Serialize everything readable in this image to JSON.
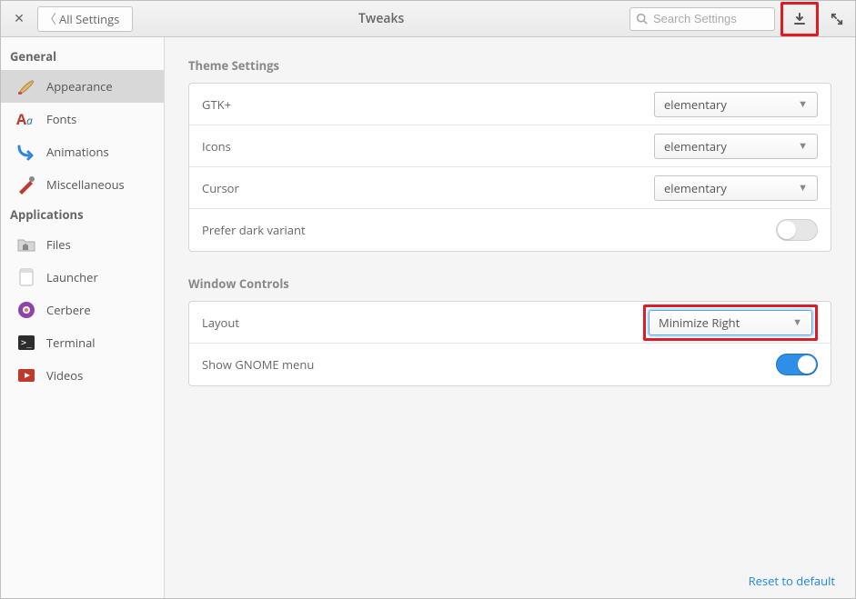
{
  "titlebar": {
    "back_label": "All Settings",
    "title": "Tweaks",
    "search_placeholder": "Search Settings"
  },
  "sidebar": {
    "groups": [
      {
        "header": "General",
        "items": [
          {
            "id": "appearance",
            "label": "Appearance",
            "icon": "brush",
            "selected": true
          },
          {
            "id": "fonts",
            "label": "Fonts",
            "icon": "fonts"
          },
          {
            "id": "animations",
            "label": "Animations",
            "icon": "arrow"
          },
          {
            "id": "misc",
            "label": "Miscellaneous",
            "icon": "knife"
          }
        ]
      },
      {
        "header": "Applications",
        "items": [
          {
            "id": "files",
            "label": "Files",
            "icon": "folder"
          },
          {
            "id": "launcher",
            "label": "Launcher",
            "icon": "page"
          },
          {
            "id": "cerbere",
            "label": "Cerbere",
            "icon": "gear"
          },
          {
            "id": "terminal",
            "label": "Terminal",
            "icon": "terminal"
          },
          {
            "id": "videos",
            "label": "Videos",
            "icon": "play"
          }
        ]
      }
    ]
  },
  "sections": {
    "theme": {
      "title": "Theme Settings",
      "rows": {
        "gtk": {
          "label": "GTK+",
          "value": "elementary"
        },
        "icons": {
          "label": "Icons",
          "value": "elementary"
        },
        "cursor": {
          "label": "Cursor",
          "value": "elementary"
        },
        "dark": {
          "label": "Prefer dark variant",
          "on": false
        }
      }
    },
    "wc": {
      "title": "Window Controls",
      "rows": {
        "layout": {
          "label": "Layout",
          "value": "Minimize Right"
        },
        "gnome": {
          "label": "Show GNOME menu",
          "on": true
        }
      }
    }
  },
  "footer": {
    "reset": "Reset to default"
  }
}
